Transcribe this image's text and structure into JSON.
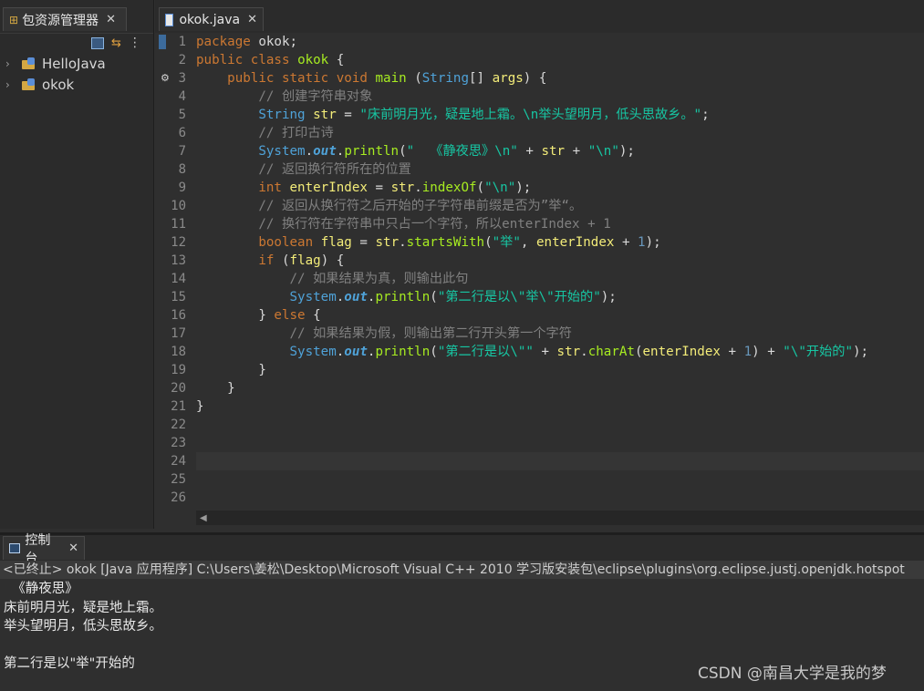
{
  "explorer": {
    "tab_label": "包资源管理器",
    "tab_close": "✕",
    "items": [
      {
        "label": "HelloJava"
      },
      {
        "label": "okok"
      }
    ]
  },
  "editor": {
    "tab_label": "okok.java",
    "tab_close": "✕",
    "line_numbers": [
      "1",
      "2",
      "3",
      "4",
      "5",
      "6",
      "7",
      "8",
      "9",
      "10",
      "11",
      "12",
      "13",
      "14",
      "15",
      "16",
      "17",
      "18",
      "19",
      "20",
      "21",
      "22",
      "23",
      "24",
      "25",
      "26"
    ]
  },
  "code": [
    "package okok;",
    "public class okok {",
    "    public static void main (String[] args) {",
    "        // 创建字符串对象",
    "        String str = \"床前明月光，疑是地上霜。\\n举头望明月，低头思故乡。\";",
    "        // 打印古诗",
    "        System.out.println(\"  《静夜思》\\n\" + str + \"\\n\");",
    "        // 返回换行符所在的位置",
    "        int enterIndex = str.indexOf(\"\\n\");",
    "        // 返回从换行符之后开始的子字符串前缀是否为”举“。",
    "        // 换行符在字符串中只占一个字符，所以enterIndex + 1",
    "        boolean flag = str.startsWith(\"举\", enterIndex + 1);",
    "        if (flag) {",
    "            // 如果结果为真，则输出此句",
    "            System.out.println(\"第二行是以\\\"举\\\"开始的\");",
    "        } else {",
    "            // 如果结果为假，则输出第二行开头第一个字符",
    "            System.out.println(\"第二行是以\\\"\" + str.charAt(enterIndex + 1) + \"\\\"开始的\");",
    "        }",
    "    }",
    "}"
  ],
  "console": {
    "tab_label": "控制台",
    "tab_close": "✕",
    "header": "<已终止> okok [Java 应用程序] C:\\Users\\姜松\\Desktop\\Microsoft Visual C++ 2010 学习版安装包\\eclipse\\plugins\\org.eclipse.justj.openjdk.hotspot",
    "output": [
      "  《静夜思》",
      "床前明月光，疑是地上霜。",
      "举头望明月，低头思故乡。",
      "",
      "第二行是以\"举\"开始的"
    ]
  },
  "watermark": "CSDN @南昌大学是我的梦"
}
